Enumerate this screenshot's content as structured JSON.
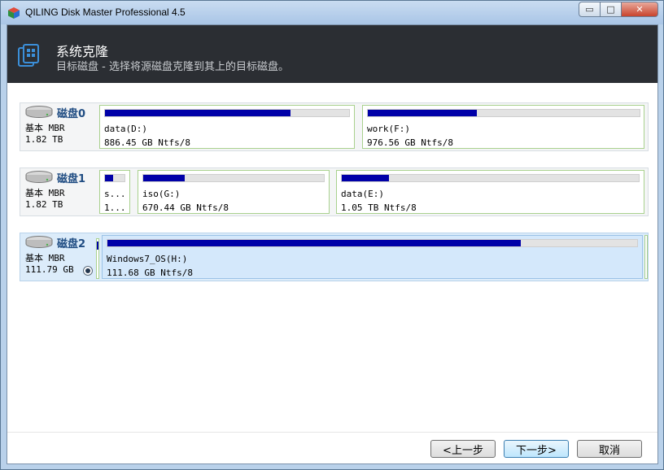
{
  "window": {
    "title": "QILING Disk Master Professional 4.5",
    "controls": {
      "minimize": "▭",
      "maximize": "□",
      "close": "✕"
    }
  },
  "header": {
    "title": "系统克隆",
    "subtitle": "目标磁盘 - 选择将源磁盘克隆到其上的目标磁盘。"
  },
  "disks": [
    {
      "name": "磁盘0",
      "type": "基本 MBR",
      "size": "1.82 TB",
      "selected": false,
      "partitions": [
        {
          "label": "data(D:)",
          "size": "886.45 GB Ntfs/8",
          "used": 0.76
        },
        {
          "label": "work(F:)",
          "size": "976.56 GB Ntfs/8",
          "used": 0.4
        }
      ]
    },
    {
      "name": "磁盘1",
      "type": "基本 MBR",
      "size": "1.82 TB",
      "selected": false,
      "partitions": [
        {
          "label": "s...",
          "size": "1...",
          "used": 0.4
        },
        {
          "label": "iso(G:)",
          "size": "670.44 GB Ntfs/8",
          "used": 0.23
        },
        {
          "label": "data(E:)",
          "size": "1.05 TB Ntfs/8",
          "used": 0.16
        }
      ]
    },
    {
      "name": "磁盘2",
      "type": "基本 MBR",
      "size": "111.79 GB",
      "selected": true,
      "partitions": [
        {
          "label": "Windows7_OS(H:)",
          "size": "111.68 GB Ntfs/8",
          "used": 0.78
        }
      ]
    }
  ],
  "buttons": {
    "back": "<上一步",
    "next": "下一步>",
    "cancel": "取消"
  },
  "colors": {
    "header_bg": "#2b2e33",
    "usage_fill": "#0000a8",
    "partition_border": "#a9d18e",
    "selected_bg": "#dcecfa"
  },
  "icons": {
    "app": "cube-app-icon",
    "header": "clone-disk-icon",
    "disk": "hard-drive-icon"
  }
}
